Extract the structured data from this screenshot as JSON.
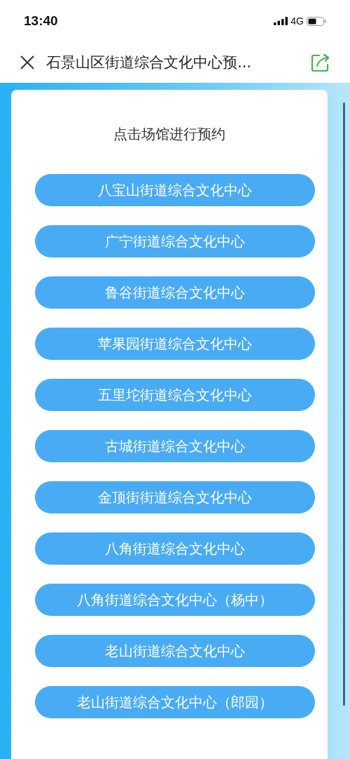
{
  "status_bar": {
    "time": "13:40",
    "network": "4G"
  },
  "nav_bar": {
    "title": "石景山区街道综合文化中心预..."
  },
  "venue_list": {
    "heading": "点击场馆进行预约",
    "venues": [
      {
        "name": "八宝山街道综合文化中心"
      },
      {
        "name": "广宁街道综合文化中心"
      },
      {
        "name": "鲁谷街道综合文化中心"
      },
      {
        "name": "苹果园街道综合文化中心"
      },
      {
        "name": "五里坨街道综合文化中心"
      },
      {
        "name": "古城街道综合文化中心"
      },
      {
        "name": "金顶街街道综合文化中心"
      },
      {
        "name": "八角街道综合文化中心"
      },
      {
        "name": "八角街道综合文化中心（杨中）"
      },
      {
        "name": "老山街道综合文化中心"
      },
      {
        "name": "老山街道综合文化中心（郎园）"
      }
    ]
  }
}
